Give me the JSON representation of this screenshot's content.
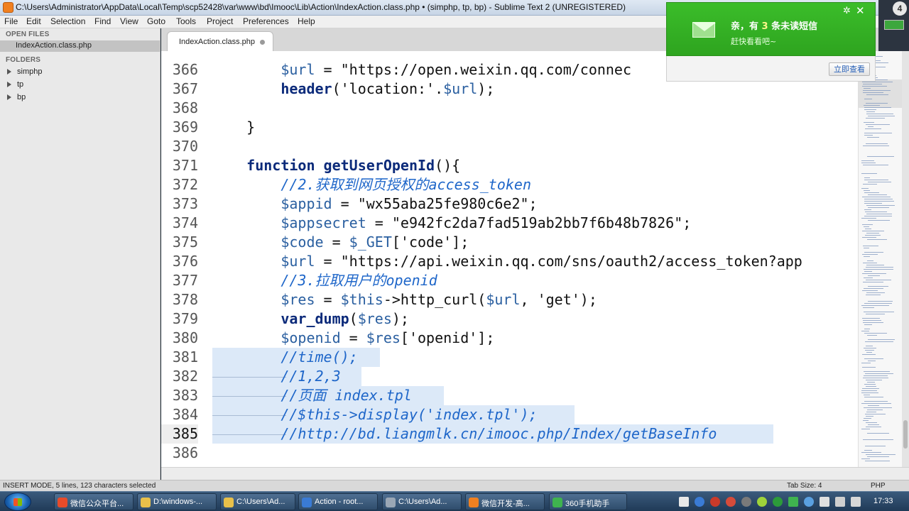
{
  "window": {
    "title": "C:\\Users\\Administrator\\AppData\\Local\\Temp\\scp52428\\var\\www\\bd\\Imooc\\Lib\\Action\\IndexAction.class.php • (simphp, tp, bp) - Sublime Text 2 (UNREGISTERED)"
  },
  "menu": [
    "File",
    "Edit",
    "Selection",
    "Find",
    "View",
    "Goto",
    "Tools",
    "Project",
    "Preferences",
    "Help"
  ],
  "sidebar": {
    "open_files_heading": "OPEN FILES",
    "open_file": "IndexAction.class.php",
    "folders_heading": "FOLDERS",
    "folders": [
      "simphp",
      "tp",
      "bp"
    ]
  },
  "tab": {
    "label": "IndexAction.class.php"
  },
  "code_lines": [
    {
      "n": "366",
      "text": "        $url = \"https://open.weixin.qq.com/connec"
    },
    {
      "n": "367",
      "text": "        header('location:'.$url);"
    },
    {
      "n": "368",
      "text": ""
    },
    {
      "n": "369",
      "text": "    }"
    },
    {
      "n": "370",
      "text": ""
    },
    {
      "n": "371",
      "text": "    function getUserOpenId(){"
    },
    {
      "n": "372",
      "text": "        //2.获取到网页授权的access_token"
    },
    {
      "n": "373",
      "text": "        $appid = \"wx55aba25fe980c6e2\";"
    },
    {
      "n": "374",
      "text": "        $appsecret = \"e942fc2da7fad519ab2bb7f6b48b7826\";"
    },
    {
      "n": "375",
      "text": "        $code = $_GET['code'];"
    },
    {
      "n": "376",
      "text": "        $url = \"https://api.weixin.qq.com/sns/oauth2/access_token?app"
    },
    {
      "n": "377",
      "text": "        //3.拉取用户的openid"
    },
    {
      "n": "378",
      "text": "        $res = $this->http_curl($url, 'get');"
    },
    {
      "n": "379",
      "text": "        var_dump($res);"
    },
    {
      "n": "380",
      "text": "        $openid = $res['openid'];"
    },
    {
      "n": "381",
      "text": "        //time();"
    },
    {
      "n": "382",
      "text": "        //1,2,3"
    },
    {
      "n": "383",
      "text": "        //页面 index.tpl"
    },
    {
      "n": "384",
      "text": "        //$this->display('index.tpl');"
    },
    {
      "n": "385",
      "text": "        //http://bd.liangmlk.cn/imooc.php/Index/getBaseInfo"
    },
    {
      "n": "386",
      "text": ""
    }
  ],
  "status": {
    "left": "INSERT MODE, 5 lines, 123 characters selected",
    "tab_size": "Tab Size: 4",
    "syntax": "PHP"
  },
  "notification": {
    "title_prefix": "亲，有",
    "count": "3",
    "title_suffix": "条未读短信",
    "subtitle": "赶快看看吧~",
    "button": "立即查看"
  },
  "gadget": {
    "badge": "4"
  },
  "taskbar": {
    "items": [
      {
        "label": "微信公众平台...",
        "color": "#e84b2a"
      },
      {
        "label": "D:\\windows-...",
        "color": "#e8c04a"
      },
      {
        "label": "C:\\Users\\Ad...",
        "color": "#e8c04a"
      },
      {
        "label": "Action - root...",
        "color": "#3a7bd5"
      },
      {
        "label": "C:\\Users\\Ad...",
        "color": "#9aa7b5"
      },
      {
        "label": "微信开发-高...",
        "color": "#f08020"
      },
      {
        "label": "360手机助手",
        "color": "#3fb34f"
      }
    ],
    "clock": "17:33"
  }
}
